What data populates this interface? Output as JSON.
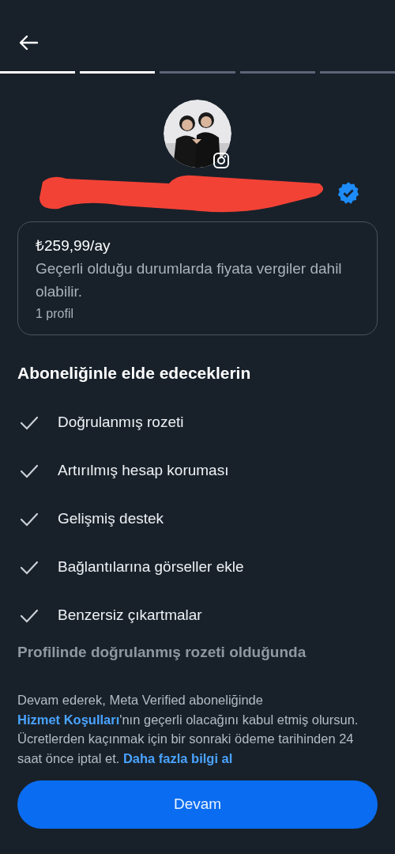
{
  "steps": [
    {
      "completed": true
    },
    {
      "completed": true
    },
    {
      "completed": false
    },
    {
      "completed": false
    },
    {
      "completed": false
    }
  ],
  "profile": {
    "verified": true
  },
  "plan": {
    "price": "₺259,99/ay",
    "note": "Geçerli olduğu durumlarda fiyata vergiler dahil olabilir.",
    "profiles": "1 profil"
  },
  "benefits_title": "Aboneliğinle elde edeceklerin",
  "benefits": [
    "Doğrulanmış rozeti",
    "Artırılmış hesap koruması",
    "Gelişmiş destek",
    "Bağlantılarına görseller ekle",
    "Benzersiz çıkartmalar"
  ],
  "cut_line": "Profilinde doğrulanmış rozeti olduğunda",
  "terms": [
    {
      "kind": "text",
      "text": "Devam ederek, Meta Verified aboneliğinde "
    },
    {
      "kind": "link",
      "text": "Hizmet Koşulları"
    },
    {
      "kind": "text",
      "text": "'nın geçerli olacağını kabul etmiş olursun. Ücretlerden kaçınmak için bir sonraki ödeme tarihinden 24 saat önce iptal et. "
    },
    {
      "kind": "link",
      "text": "Daha fazla bilgi al"
    }
  ],
  "continue_button": "Devam"
}
